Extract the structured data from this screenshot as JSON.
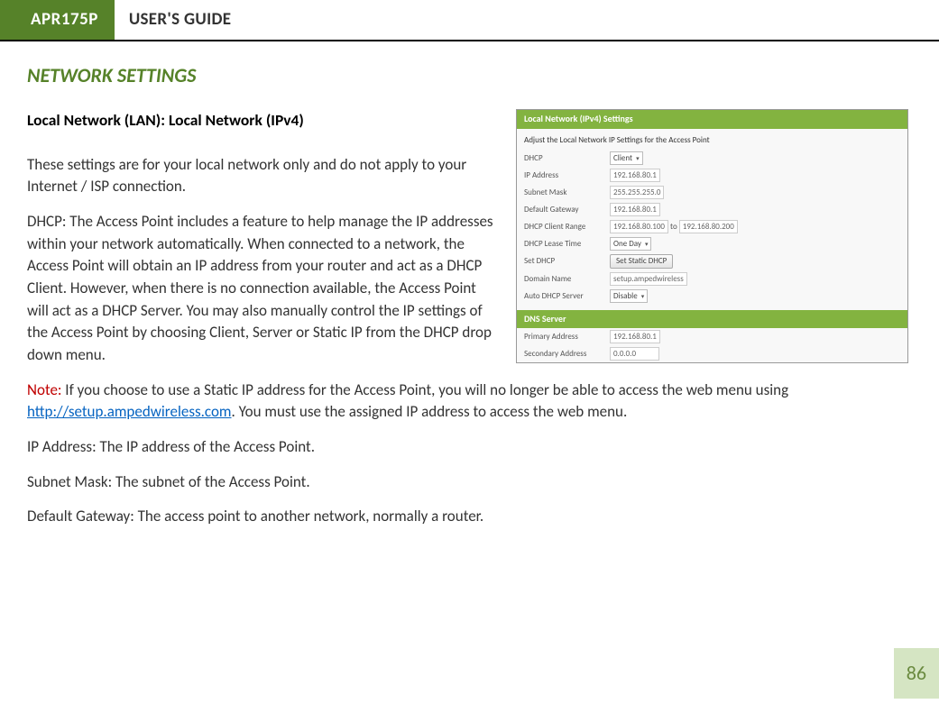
{
  "header": {
    "model": "APR175P",
    "title": "USER'S GUIDE"
  },
  "section_title": "NETWORK SETTINGS",
  "subsection_title": "Local Network (LAN): Local Network (IPv4)",
  "paragraphs": {
    "p1": "These settings are for your local network only and do not apply to your Internet / ISP connection.",
    "p2": "DHCP: The Access Point includes a feature to help manage the IP addresses within your network automatically. When connected to a network, the Access Point will obtain an IP address from your router and act as a DHCP Client. However, when there is no connection available, the Access Point will act as a DHCP Server. You may also manually control the IP settings of the Access Point by choosing Client, Server or Static IP from the DHCP drop down menu.",
    "note_label": "Note:",
    "p3a": " If you choose to use a Static IP address for the Access Point, you will no longer be able to access the web menu using ",
    "p3_link": "http://setup.ampedwireless.com",
    "p3b": ".  You must use the assigned IP address to access the web menu.",
    "p4": "IP Address: The IP address of the Access Point.",
    "p5": "Subnet Mask: The subnet of the Access Point.",
    "p6": "Default Gateway: The access point to another network, normally a router."
  },
  "figure": {
    "bar1": "Local Network (IPv4) Settings",
    "note": "Adjust the Local Network IP Settings for the Access Point",
    "rows": [
      {
        "label": "DHCP",
        "type": "select",
        "value": "Client"
      },
      {
        "label": "IP Address",
        "type": "input",
        "value": "192.168.80.1"
      },
      {
        "label": "Subnet Mask",
        "type": "input",
        "value": "255.255.255.0"
      },
      {
        "label": "Default Gateway",
        "type": "input",
        "value": "192.168.80.1"
      },
      {
        "label": "DHCP Client Range",
        "type": "range",
        "from": "192.168.80.100",
        "to_label": "to",
        "to": "192.168.80.200"
      },
      {
        "label": "DHCP Lease Time",
        "type": "select",
        "value": "One Day"
      },
      {
        "label": "Set DHCP",
        "type": "button",
        "value": "Set Static DHCP"
      },
      {
        "label": "Domain Name",
        "type": "input",
        "value": "setup.ampedwireless"
      },
      {
        "label": "Auto DHCP Server",
        "type": "select",
        "value": "Disable"
      }
    ],
    "bar2": "DNS Server",
    "dns": [
      {
        "label": "Primary Address",
        "value": "192.168.80.1"
      },
      {
        "label": "Secondary Address",
        "value": "0.0.0.0"
      }
    ]
  },
  "page_number": "86"
}
